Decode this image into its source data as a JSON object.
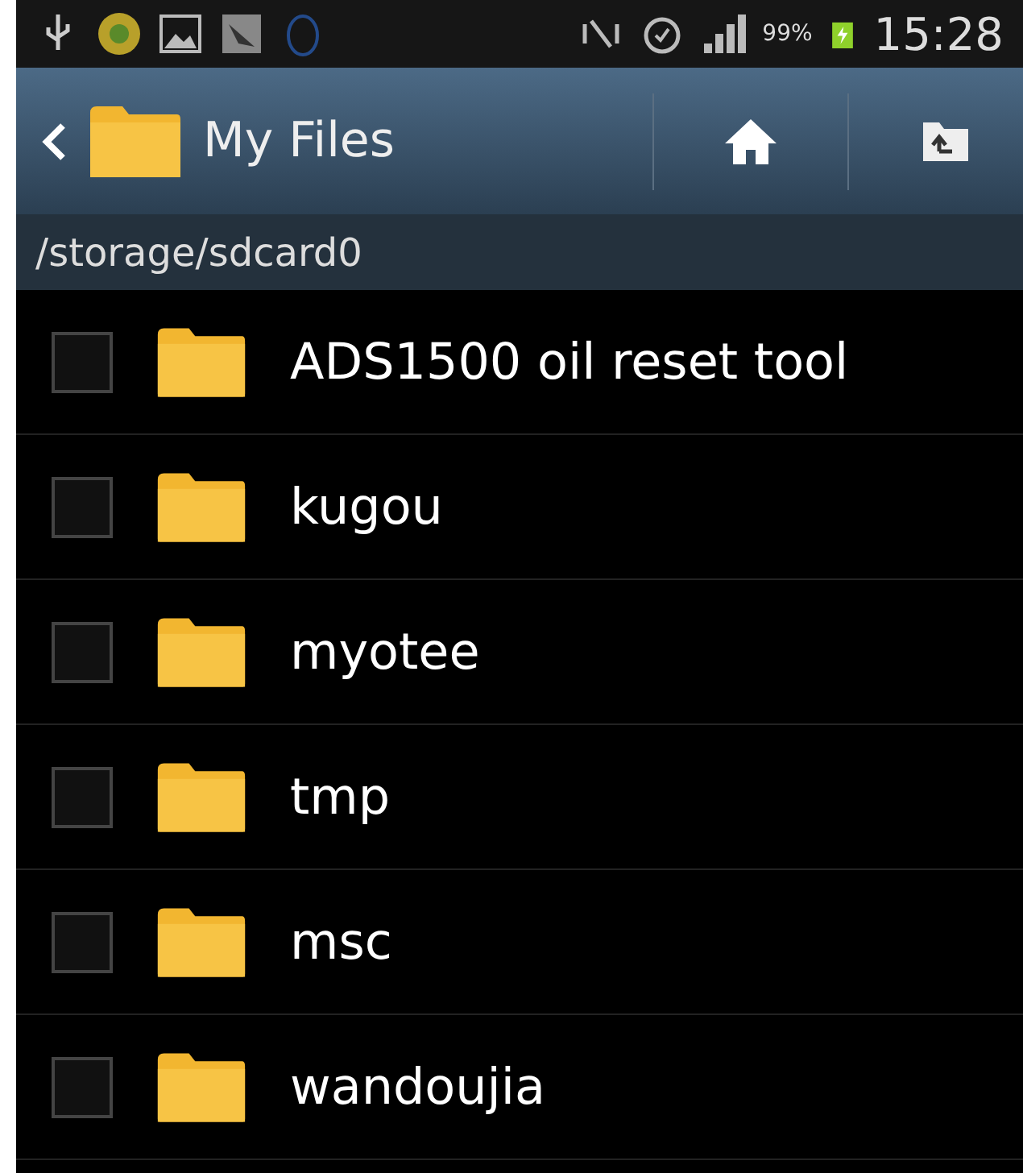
{
  "status_bar": {
    "battery": "99%",
    "time": "15:28"
  },
  "action_bar": {
    "title": "My Files"
  },
  "path": "/storage/sdcard0",
  "files": [
    {
      "name": "ADS1500 oil reset tool",
      "checked": false
    },
    {
      "name": "kugou",
      "checked": false
    },
    {
      "name": "myotee",
      "checked": false
    },
    {
      "name": "tmp",
      "checked": false
    },
    {
      "name": "msc",
      "checked": false
    },
    {
      "name": "wandoujia",
      "checked": false
    }
  ]
}
